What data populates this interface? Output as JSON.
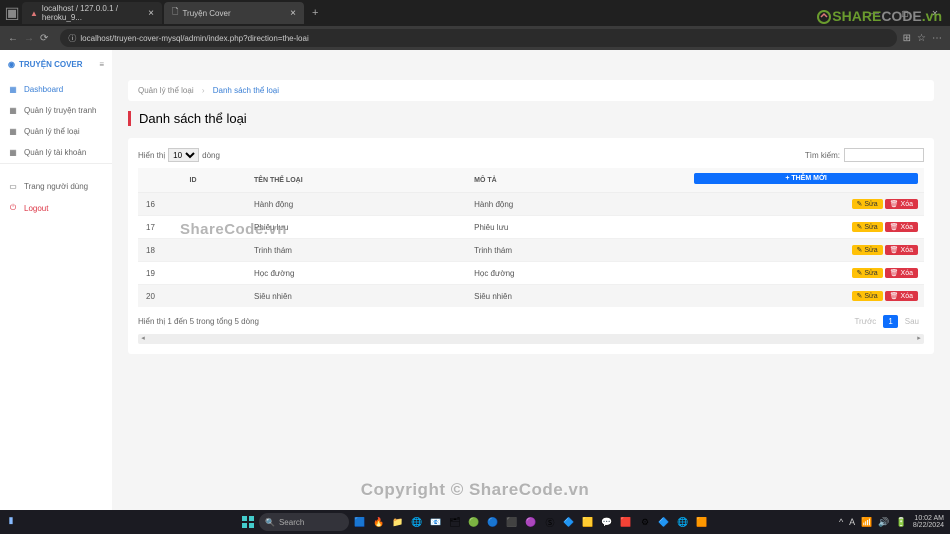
{
  "browser": {
    "tab1": "localhost / 127.0.0.1 / heroku_9...",
    "tab2": "Truyện Cover",
    "url": "localhost/truyen-cover-mysql/admin/index.php?direction=the-loai"
  },
  "watermark": {
    "logo_share": "SHARE",
    "logo_code": "CODE",
    "logo_vn": ".vn",
    "text1": "ShareCode.vn",
    "text2": "Copyright © ShareCode.vn"
  },
  "sidebar": {
    "brand": "TRUYỆN COVER",
    "items": [
      {
        "icon": "▦",
        "label": "Dashboard",
        "cls": "active"
      },
      {
        "icon": "▦",
        "label": "Quản lý truyện tranh",
        "cls": ""
      },
      {
        "icon": "▦",
        "label": "Quản lý thể loại",
        "cls": ""
      },
      {
        "icon": "▦",
        "label": "Quản lý tài khoản",
        "cls": ""
      }
    ],
    "user": {
      "icon": "▭",
      "label": "Trang người dùng"
    },
    "logout": {
      "icon": "→",
      "label": "Logout"
    }
  },
  "breadcrumb": {
    "parent": "Quản lý thể loại",
    "current": "Danh sách thể loại"
  },
  "page_title": "Danh sách thể loại",
  "table": {
    "show_prefix": "Hiển thị",
    "show_suffix": "dòng",
    "select_value": "10",
    "search_label": "Tìm kiếm:",
    "add_label": "+ THÊM MỚI",
    "headers": {
      "id": "ID",
      "name": "TÊN THỂ LOẠI",
      "desc": "MÔ TẢ"
    },
    "edit_label": "Sửa",
    "del_label": "Xóa",
    "rows": [
      {
        "id": "16",
        "name": "Hành động",
        "desc": "Hành động"
      },
      {
        "id": "17",
        "name": "Phiêu lưu",
        "desc": "Phiêu lưu"
      },
      {
        "id": "18",
        "name": "Trinh thám",
        "desc": "Trinh thám"
      },
      {
        "id": "19",
        "name": "Học đường",
        "desc": "Học đường"
      },
      {
        "id": "20",
        "name": "Siêu nhiên",
        "desc": "Siêu nhiên"
      }
    ],
    "info": "Hiển thị 1 đến 5 trong tổng 5 dòng",
    "prev": "Trước",
    "page": "1",
    "next": "Sau"
  },
  "taskbar": {
    "search": "Search",
    "time": "10:02 AM",
    "date": "8/22/2024"
  }
}
